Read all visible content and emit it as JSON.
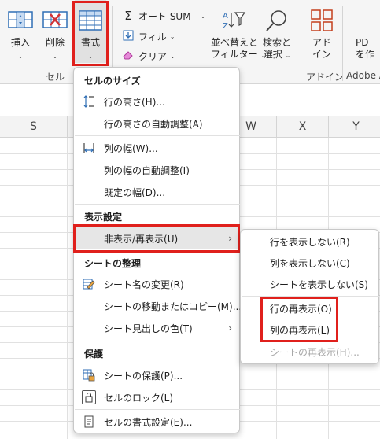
{
  "ribbon": {
    "insert": {
      "label": "挿入",
      "icon": "insert-cells-icon"
    },
    "delete": {
      "label": "削除",
      "icon": "delete-cells-icon"
    },
    "format": {
      "label": "書式",
      "icon": "format-cells-icon"
    },
    "autosum": {
      "label": "オート SUM",
      "icon": "sigma-icon"
    },
    "fill": {
      "label": "フィル",
      "icon": "fill-down-icon"
    },
    "clear": {
      "label": "クリア",
      "icon": "eraser-icon"
    },
    "sort_filter": {
      "line1": "並べ替えと",
      "line2": "フィルター",
      "icon": "sort-filter-icon"
    },
    "find_select": {
      "line1": "検索と",
      "line2": "選択",
      "icon": "magnifier-icon"
    },
    "addins": {
      "line1": "アド",
      "line2": "イン",
      "icon": "addins-grid-icon"
    },
    "pdf": {
      "line1": "PD",
      "line2": "を作"
    },
    "groups": {
      "cells": "セル",
      "addins": "アドイン",
      "adobe": "Adobe A"
    },
    "highlight_color": "#e0201c"
  },
  "columns": [
    "S",
    "W",
    "X",
    "Y"
  ],
  "menu": {
    "cell_size": {
      "header": "セルのサイズ",
      "row_height": "行の高さ(H)...",
      "autofit_row": "行の高さの自動調整(A)",
      "col_width": "列の幅(W)...",
      "autofit_col": "列の幅の自動調整(I)",
      "default_width": "既定の幅(D)..."
    },
    "visibility": {
      "header": "表示設定",
      "hide_unhide": "非表示/再表示(U)"
    },
    "organize": {
      "header": "シートの整理",
      "rename": "シート名の変更(R)",
      "move_copy": "シートの移動またはコピー(M)...",
      "tab_color": "シート見出しの色(T)"
    },
    "protection": {
      "header": "保護",
      "protect_sheet": "シートの保護(P)...",
      "lock_cell": "セルのロック(L)",
      "format_cells": "セルの書式設定(E)..."
    }
  },
  "submenu": {
    "hide_rows": "行を表示しない(R)",
    "hide_cols": "列を表示しない(C)",
    "hide_sheet": "シートを表示しない(S)",
    "unhide_rows": "行の再表示(O)",
    "unhide_cols": "列の再表示(L)",
    "unhide_sheet": "シートの再表示(H)..."
  }
}
